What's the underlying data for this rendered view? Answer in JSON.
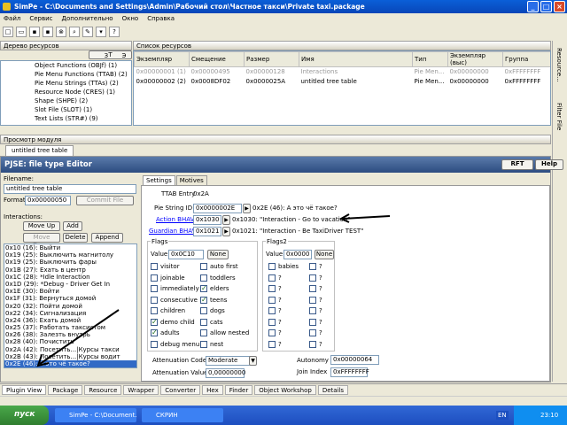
{
  "window": {
    "title": "SimPe - C:\\Documents and Settings\\Admin\\Рабочий стол\\Частное такси\\Private taxi.package"
  },
  "menu": [
    "Файл",
    "Сервис",
    "Дополнительно",
    "Окно",
    "Справка"
  ],
  "resource_tree": {
    "header": "Дерево ресурсов",
    "items": [
      "Object Functions (OBJf) (1)",
      "Pie Menu Functions (TTAB) (2)",
      "Pie Menu Strings (TTAs) (2)",
      "Resource Node (CRES) (1)",
      "Shape (SHPE) (2)",
      "Slot File (SLOT) (1)",
      "Text Lists (STR#) (9)"
    ],
    "tabs": [
      "T",
      "З",
      "Э"
    ]
  },
  "resource_list": {
    "header": "Список ресурсов",
    "columns": [
      "Экземпляр",
      "Смещение",
      "Размер",
      "Имя",
      "Тип",
      "Экземпляр (выс)",
      "Группа"
    ],
    "rows": [
      [
        "0x00000001 (1)",
        "0x00000495",
        "0x00000128",
        "Interactions",
        "Pie Men...",
        "0x00000000",
        "0xFFFFFFFF"
      ],
      [
        "0x00000002 (2)",
        "0x0008DF02",
        "0x0000025A",
        "untitled tree table",
        "Pie Men...",
        "0x00000000",
        "0xFFFFFFFF"
      ]
    ]
  },
  "side_tabs": [
    "Resource...",
    "Filter File"
  ],
  "preview": {
    "header": "Просмотр модуля",
    "tab": "untitled tree table"
  },
  "editor": {
    "title": "PJSE: file type Editor",
    "rft_label": "RFT",
    "help_label": "Help",
    "filename_label": "Filename:",
    "filename": "untitled tree table",
    "format_label": "Format",
    "format": "0x00000050",
    "commit_label": "Commit File",
    "interactions_label": "Interactions:",
    "move_up": "Move Up",
    "add": "Add",
    "move_down": "Move Down",
    "delete": "Delete",
    "append": "Append",
    "interactions": [
      "0x10 (16): Выйти",
      "0x19 (25): Выключить магнитолу",
      "0x19 (25): Выключить фары",
      "0x1B (27): Ехать в центр",
      "0x1C (28): *Idle Interaction",
      "0x1D (29): *Debug - Driver Get In",
      "0x1E (30): Войти",
      "0x1F (31): Вернуться домой",
      "0x20 (32): Пойти домой",
      "0x22 (34): Сигнализация",
      "0x24 (36): Ехать домой",
      "0x25 (37): Работать таксистом",
      "0x26 (38): Залезть внутрь",
      "0x28 (40): Почистить",
      "0x2A (42): Посетить...|Курсы такси",
      "0x2B (43): Посетить...|Курсы водит",
      "0x2E (46): А это чё такое?"
    ],
    "tabs": [
      "Settings",
      "Motives"
    ],
    "ttab_entry_label": "TTAB Entry",
    "ttab_entry": "0x2A",
    "pie_string_label": "Pie String ID",
    "pie_string": "0x0000002E",
    "pie_string_desc": "0x2E (46): А это чё такое?",
    "action_label": "Action BHAV",
    "action": "0x1030",
    "action_desc": "0x1030: \"Interaction - Go to vacation\"",
    "guardian_label": "Guardian BHAV",
    "guardian": "0x1021",
    "guardian_desc": "0x1021: \"Interaction - Be TaxiDriver TEST\"",
    "flags_label": "Flags",
    "flags2_label": "Flags2",
    "value_label": "Value",
    "flags_value": "0x0C10",
    "flags2_value": "0x0000",
    "none_label": "None",
    "flags": [
      {
        "name": "visitor",
        "on": false
      },
      {
        "name": "auto first",
        "on": false
      },
      {
        "name": "joinable",
        "on": false
      },
      {
        "name": "toddlers",
        "on": false
      },
      {
        "name": "immediately",
        "on": false
      },
      {
        "name": "elders",
        "on": true
      },
      {
        "name": "consecutive",
        "on": false
      },
      {
        "name": "teens",
        "on": true
      },
      {
        "name": "children",
        "on": false
      },
      {
        "name": "dogs",
        "on": false
      },
      {
        "name": "demo child",
        "on": true
      },
      {
        "name": "cats",
        "on": false
      },
      {
        "name": "adults",
        "on": true
      },
      {
        "name": "allow nested",
        "on": false
      },
      {
        "name": "debug menu",
        "on": false
      },
      {
        "name": "nest",
        "on": false
      }
    ],
    "flags2": [
      "babies",
      "?",
      "?",
      "?",
      "?",
      "?",
      "?",
      "?",
      "?",
      "?",
      "?",
      "?",
      "?",
      "?",
      "?",
      "?"
    ],
    "attenuation_code_label": "Attenuation Code",
    "attenuation_code": "Moderate",
    "attenuation_value_label": "Attenuation Value",
    "attenuation_value": "0,00000000",
    "autonomy_label": "Autonomy",
    "autonomy": "0x00000064",
    "join_index_label": "Join Index",
    "join_index": "0xFFFFFFFF"
  },
  "bottom_tabs": [
    "Plugin View",
    "Package",
    "Resource",
    "Wrapper",
    "Converter",
    "Hex",
    "Finder",
    "Object Workshop",
    "Details"
  ],
  "taskbar": {
    "start": "пуск",
    "tasks": [
      "SimPe - C:\\Document...",
      "СКРИН"
    ],
    "lang": "EN",
    "clock": "23:10"
  }
}
